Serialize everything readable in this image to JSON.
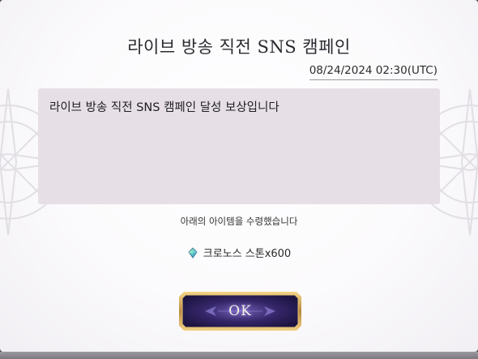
{
  "dialog": {
    "title": "라이브 방송 직전 SNS 캠페인",
    "date": "08/24/2024 02:30(UTC)",
    "message": "라이브 방송 직전 SNS 캠페인 달성 보상입니다",
    "received_text": "아래의 아이템을 수령했습니다",
    "reward": {
      "icon": "chronos-stone-icon",
      "label": "크로노스 스톤x600"
    },
    "ok_label": "OK"
  },
  "colors": {
    "message_box": "#e6e0e6",
    "button_fill": "#2d1f5e",
    "button_frame": "#c9a35b"
  }
}
